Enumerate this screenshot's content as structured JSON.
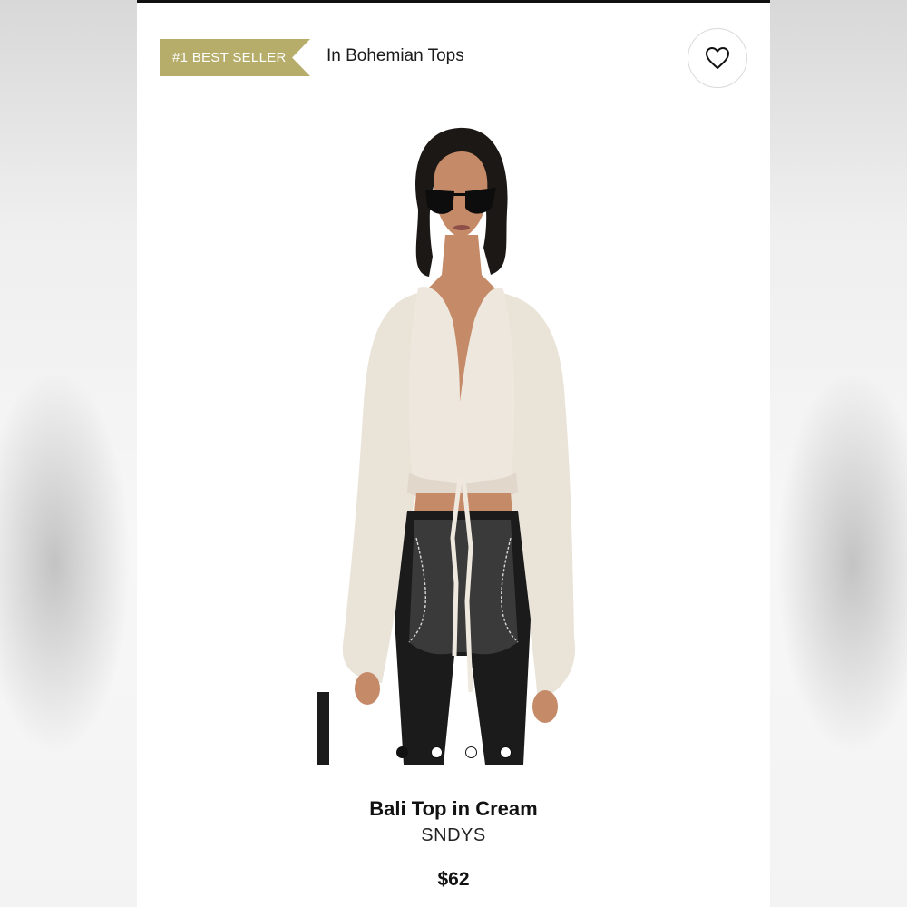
{
  "header": {
    "badge_label": "#1 BEST SELLER",
    "category_label": "In Bohemian Tops",
    "favorite_icon": "heart-icon"
  },
  "colors": {
    "badge_bg": "#b6ad6a",
    "text": "#111111"
  },
  "gallery": {
    "image_count": 4,
    "active_index": 0
  },
  "product": {
    "name": "Bali Top in Cream",
    "brand": "SNDYS",
    "price": "$62"
  }
}
